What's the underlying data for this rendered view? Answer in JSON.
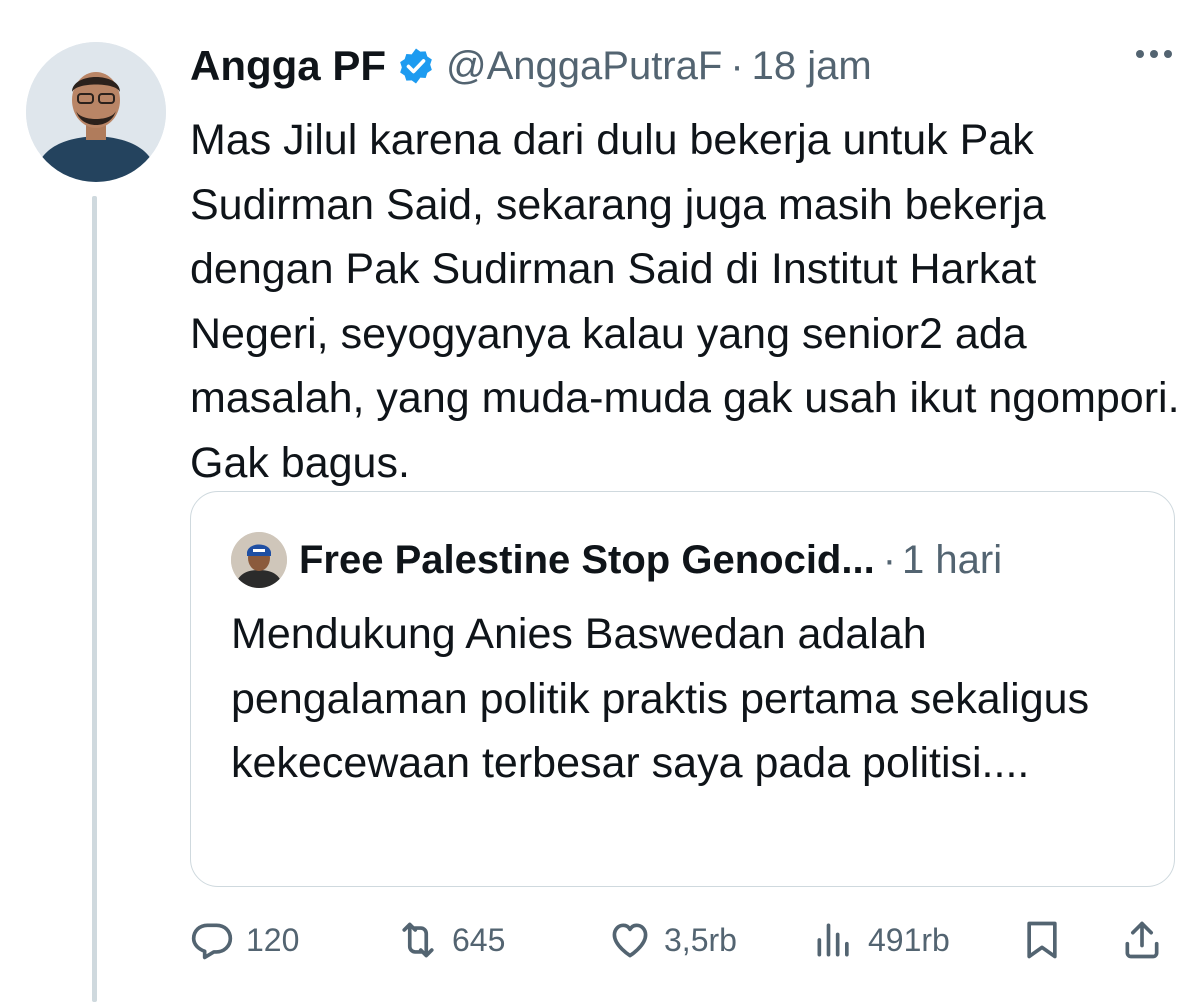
{
  "tweet": {
    "author": {
      "name": "Angga PF",
      "handle": "@AnggaPutraF",
      "separator": "·",
      "time": "18 jam"
    },
    "text": "Mas Jilul karena dari dulu bekerja untuk Pak Sudirman Said, sekarang juga masih bekerja dengan Pak Sudirman Said di Institut Harkat Negeri, seyogyanya kalau yang senior2 ada masalah, yang muda-muda gak usah ikut ngompori. Gak bagus.",
    "quoted": {
      "author_name": "Free Palestine Stop Genocid...",
      "separator": "·",
      "time": "1 hari",
      "text": "Mendukung Anies Baswedan adalah pengalaman politik praktis pertama sekaligus kekecewaan terbesar saya pada politisi...."
    },
    "actions": {
      "replies": "120",
      "reposts": "645",
      "likes": "3,5rb",
      "views": "491rb"
    }
  },
  "icons": {
    "verified": "verified-badge-icon",
    "more": "more-dots-icon",
    "reply": "reply-icon",
    "repost": "repost-icon",
    "like": "heart-icon",
    "views": "views-chart-icon",
    "bookmark": "bookmark-icon",
    "share": "share-icon"
  },
  "colors": {
    "text": "#0f1419",
    "secondary": "#536471",
    "border": "#cfd9de",
    "verified": "#1d9bf0"
  }
}
